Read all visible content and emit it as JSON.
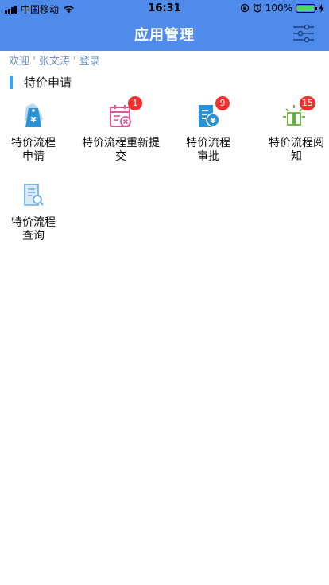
{
  "status_bar": {
    "carrier": "中国移动",
    "time": "16:31",
    "battery": "100%",
    "battery_level": 1.0
  },
  "nav": {
    "title": "应用管理"
  },
  "welcome": {
    "prefix": "欢迎",
    "user": "' 张文涛 '",
    "suffix": "登录"
  },
  "section": {
    "title": "特价申请"
  },
  "tiles": [
    {
      "label": "特价流程申请",
      "icon": "price-tag-icon",
      "badge": ""
    },
    {
      "label": "特价流程重新提交",
      "icon": "calendar-cancel-icon",
      "badge": "1"
    },
    {
      "label": "特价流程审批",
      "icon": "document-yuan-icon",
      "badge": "9"
    },
    {
      "label": "特价流程阅知",
      "icon": "open-book-light-icon",
      "badge": "15"
    },
    {
      "label": "特价流程查询",
      "icon": "document-search-icon",
      "badge": ""
    }
  ],
  "colors": {
    "nav_background": "#4f8bea",
    "accent_bar": "#3da2f0",
    "badge": "#f23030",
    "welcome_text": "#6f8dc6",
    "icon_blue": "#2a93d8",
    "icon_pink": "#e0559a",
    "icon_green": "#5cb130"
  }
}
